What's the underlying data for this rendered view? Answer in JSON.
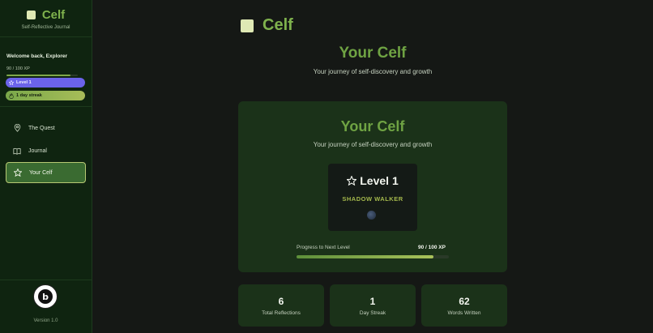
{
  "app": {
    "name": "Celf",
    "tagline": "Self-Reflective Journal",
    "version": "Version 1.0",
    "accent": "#7fb24d"
  },
  "user": {
    "welcome": "Welcome back, Explorer",
    "xp_text": "90 / 100 XP",
    "xp_progress": 0.9,
    "level_badge": "Level 1",
    "streak_badge": "1 day streak"
  },
  "nav": {
    "items": [
      {
        "label": "The Quest",
        "icon": "map-pin-icon",
        "active": false
      },
      {
        "label": "Journal",
        "icon": "book-icon",
        "active": false
      },
      {
        "label": "Your Celf",
        "icon": "star-icon",
        "active": true
      }
    ]
  },
  "main": {
    "title": "Your Celf",
    "subtitle": "Your journey of self-discovery and growth",
    "card": {
      "title": "Your Celf",
      "subtitle": "Your journey of self-discovery and growth",
      "level": "Level 1",
      "rank": "SHADOW WALKER",
      "progress_label": "Progress to Next Level",
      "progress_xp": "90 / 100 XP",
      "progress": 0.9
    },
    "stats": [
      {
        "value": "6",
        "label": "Total Reflections"
      },
      {
        "value": "1",
        "label": "Day Streak"
      },
      {
        "value": "62",
        "label": "Words Written"
      }
    ]
  }
}
